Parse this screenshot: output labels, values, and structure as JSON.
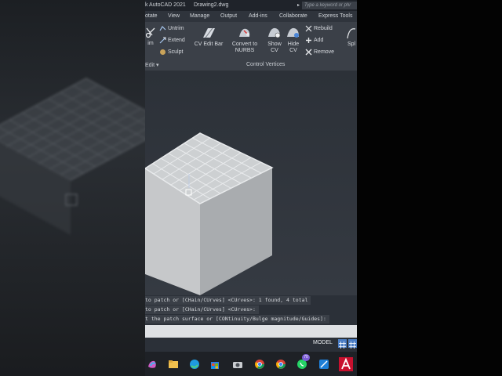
{
  "titlebar": {
    "title": "k AutoCAD 2021",
    "document": "Drawing2.dwg",
    "search_placeholder": "Type a keyword or phr"
  },
  "menu": [
    "otate",
    "View",
    "Manage",
    "Output",
    "Add-ins",
    "Collaborate",
    "Express Tools"
  ],
  "ribbon": {
    "trim_label": "im",
    "untrim_label": "Untrim",
    "extend_label": "Extend",
    "sculpt_label": "Sculpt",
    "edit_panel_label": "Edit",
    "cv_edit_bar_label": "CV Edit Bar",
    "convert_label_1": "Convert to",
    "convert_label_2": "NURBS",
    "show_cv_1": "Show",
    "show_cv_2": "CV",
    "hide_cv_1": "Hide",
    "hide_cv_2": "CV",
    "rebuild_label": "Rebuild",
    "add_label": "Add",
    "remove_label": "Remove",
    "control_vertices_label": "Control Vertices",
    "spline_label": "Spl"
  },
  "command_history": [
    "to patch or [CHain/CUrves] <CUrves>: 1 found, 4 total",
    "to patch or [CHain/CUrves] <CUrves>:",
    "t the patch surface or [CONtinuity/Bulge magnitude/Guides]:"
  ],
  "command_input_value": "",
  "status": {
    "model_label": "MODEL"
  },
  "taskbar": {
    "whatsapp_badge": "70"
  },
  "colors": {
    "accent": "#4b7dc4",
    "autocad": "#c8102e"
  }
}
